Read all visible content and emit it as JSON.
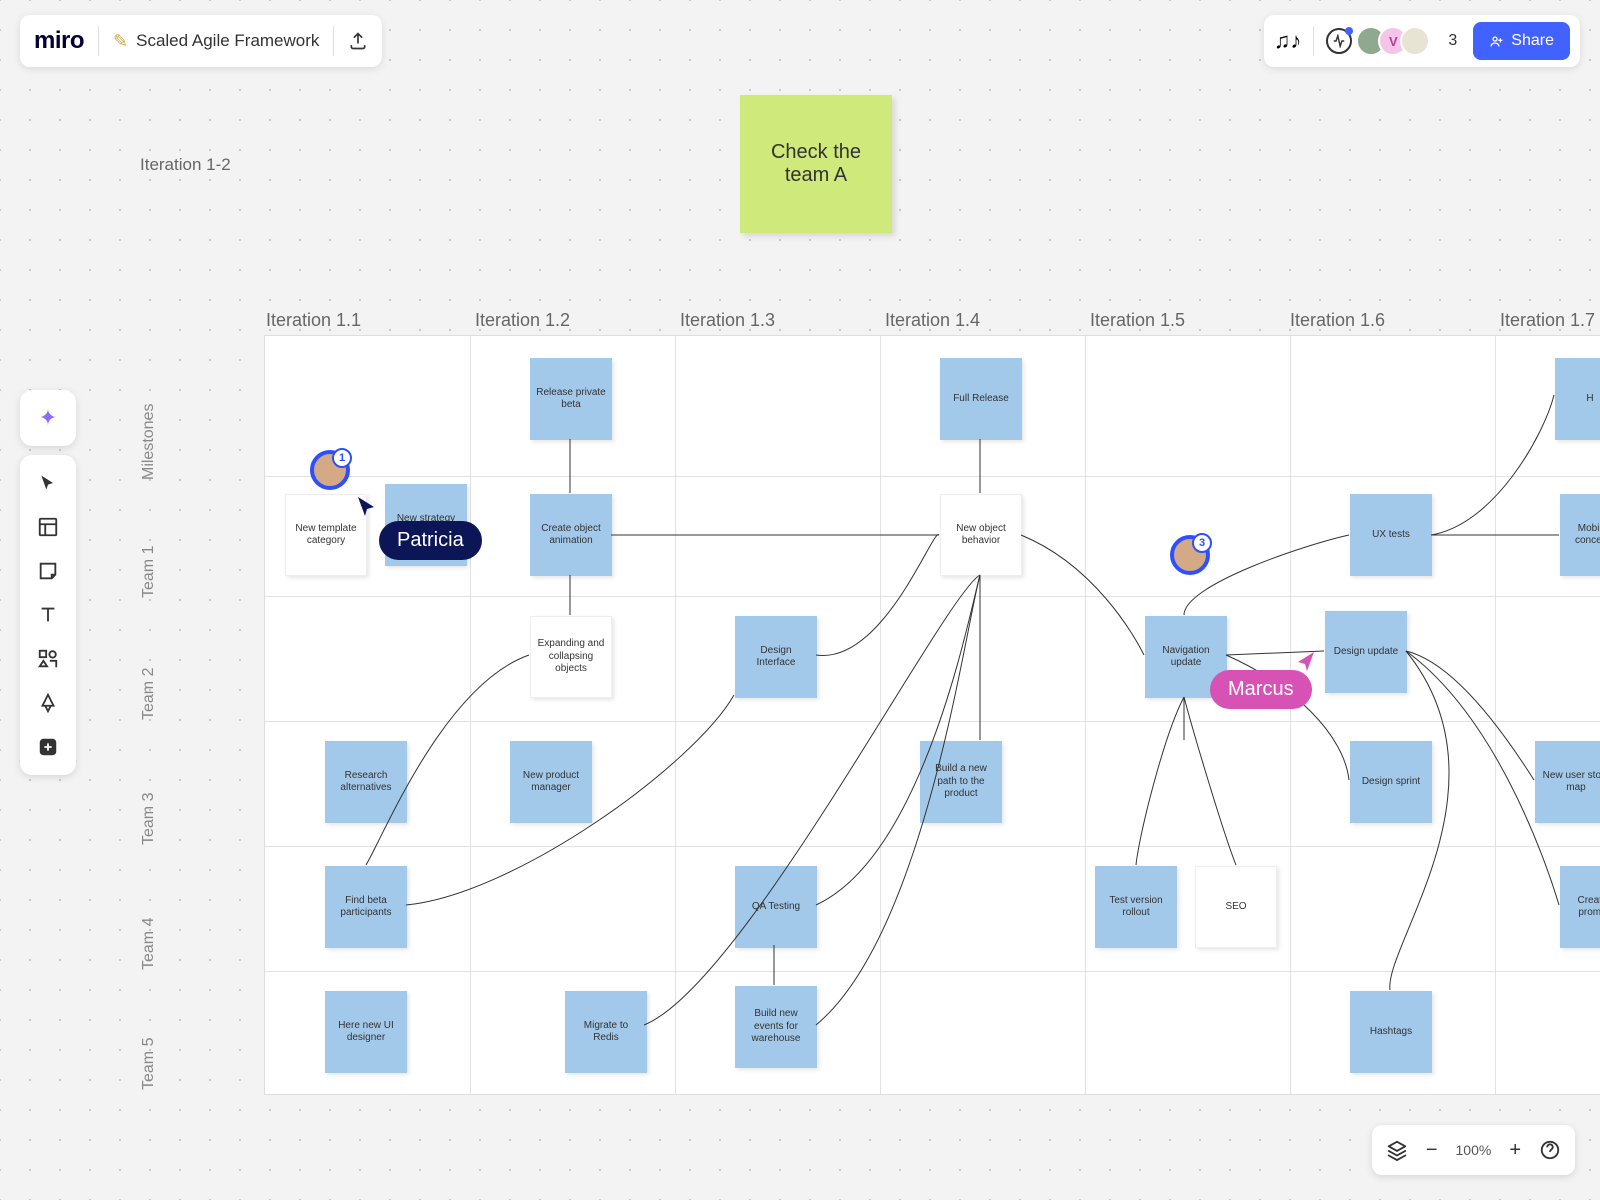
{
  "app": {
    "logo": "miro",
    "boardName": "Scaled Agile Framework"
  },
  "header": {
    "guestCount": "3",
    "shareLabel": "Share"
  },
  "canvas": {
    "iterationGroup": "Iteration 1-2",
    "stickyNote": "Check the team A",
    "columns": [
      "Iteration 1.1",
      "Iteration 1.2",
      "Iteration 1.3",
      "Iteration 1.4",
      "Iteration 1.5",
      "Iteration 1.6",
      "Iteration 1.7"
    ],
    "rows": [
      "Milestones",
      "Team 1",
      "Team 2",
      "Team 3",
      "Team 4",
      "Team 5"
    ]
  },
  "cards": {
    "c1": "Release private beta",
    "c2": "Full Release",
    "c3": "New template category",
    "c4": "New strategy metod",
    "c5": "Create object animation",
    "c6": "New object behavior",
    "c7": "UX tests",
    "c8": "Mobile concept",
    "c9": "Expanding and collapsing objects",
    "c10": "Design Interface",
    "c11": "Navigation update",
    "c12": "Design update",
    "c13": "Research alternatives",
    "c14": "New product manager",
    "c15": "Build a new path to the product",
    "c16": "Design sprint",
    "c17": "New user story map",
    "c18": "Find beta participants",
    "c19": "QA Testing",
    "c20": "Test version rollout",
    "c21": "SEO",
    "c22": "Create promo",
    "c23": "Here new UI designer",
    "c24": "Migrate to Redis",
    "c25": "Build new events for warehouse",
    "c26": "Hashtags",
    "c27": "H"
  },
  "cursors": {
    "patricia": "Patricia",
    "marcus": "Marcus"
  },
  "presence": {
    "p1": "1",
    "p2": "3"
  },
  "bottom": {
    "zoom": "100%"
  }
}
